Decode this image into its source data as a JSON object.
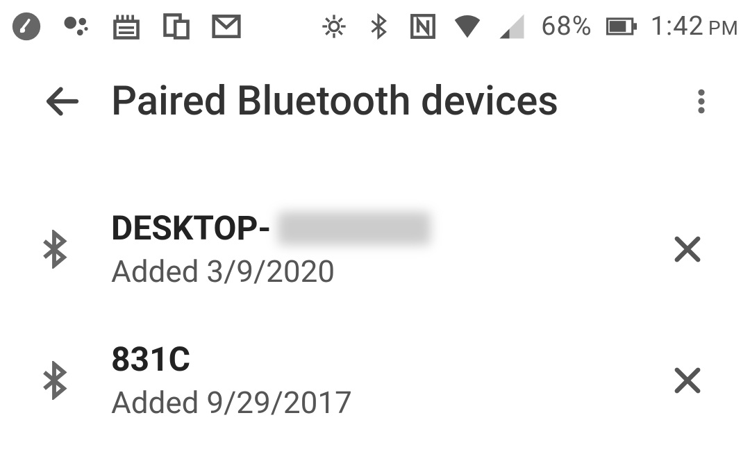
{
  "status_bar": {
    "battery_percent": "68%",
    "time": "1:42",
    "ampm": "PM"
  },
  "header": {
    "title": "Paired Bluetooth devices"
  },
  "devices": [
    {
      "name": "DESKTOP-",
      "name_obscured": true,
      "added_label": "Added 3/9/2020"
    },
    {
      "name": "831C",
      "name_obscured": false,
      "added_label": "Added 9/29/2017"
    }
  ]
}
